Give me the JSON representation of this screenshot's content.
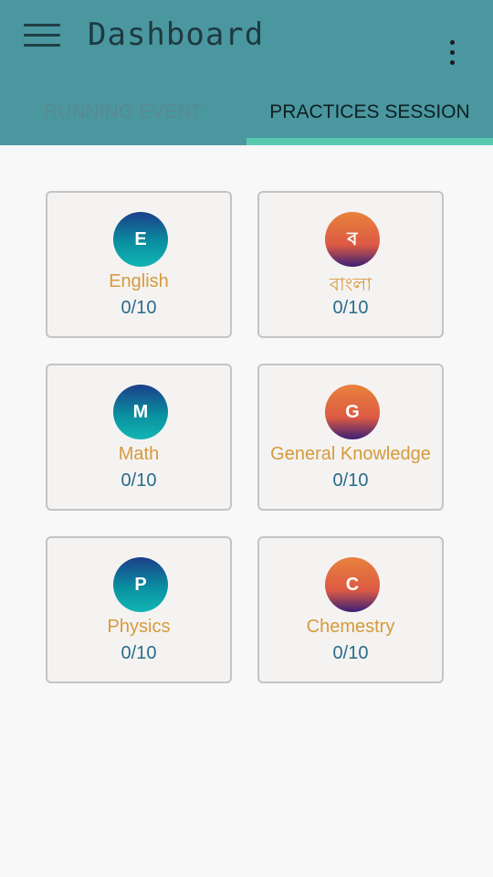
{
  "app": {
    "title": "Dashboard"
  },
  "tabs": [
    {
      "label": "RUNNING EVENT",
      "selected": false
    },
    {
      "label": "PRACTICES SESSION",
      "selected": true
    }
  ],
  "cards": [
    {
      "initial": "E",
      "subject": "English",
      "score": "0/10",
      "accent": "blue"
    },
    {
      "initial": "ব",
      "subject": "বাংলা",
      "score": "0/10",
      "accent": "orange"
    },
    {
      "initial": "M",
      "subject": "Math",
      "score": "0/10",
      "accent": "blue"
    },
    {
      "initial": "G",
      "subject": "General Knowledge",
      "score": "0/10",
      "accent": "orange"
    },
    {
      "initial": "P",
      "subject": "Physics",
      "score": "0/10",
      "accent": "blue"
    },
    {
      "initial": "C",
      "subject": "Chemestry",
      "score": "0/10",
      "accent": "orange"
    }
  ],
  "colors": {
    "header": "#4a97a0",
    "tab_indicator": "#59c9b2",
    "subject_text": "#d69a3b",
    "score_text": "#2a6b8a"
  },
  "icons": [
    "hamburger-menu-icon",
    "more-vert-icon"
  ]
}
